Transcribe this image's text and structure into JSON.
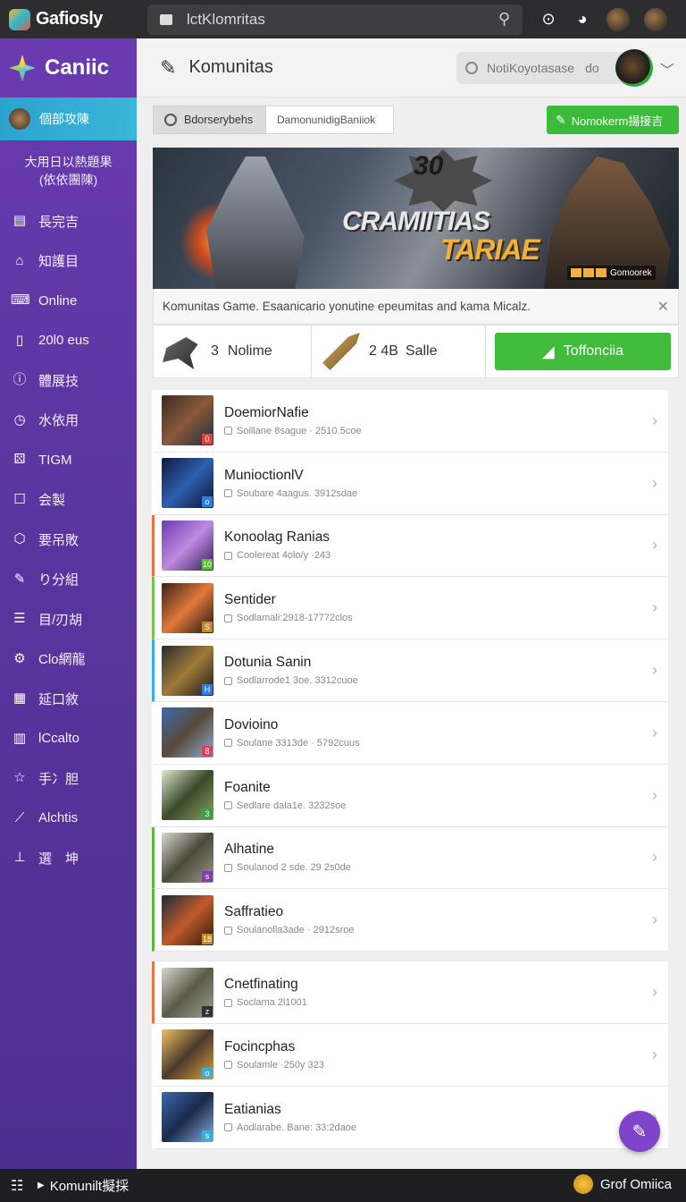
{
  "app": {
    "brand": "Gafiosly"
  },
  "url": {
    "text": "lctKlomritas"
  },
  "sidebar": {
    "title": "Caniic",
    "active_item": "個部攻陳",
    "subtitle_line1": "大用日以熱題果",
    "subtitle_line2": "(依依團陳)",
    "items": [
      {
        "label": "長完吉",
        "icon": "document-icon"
      },
      {
        "label": "知護目",
        "icon": "bag-icon"
      },
      {
        "label": "Online",
        "icon": "terminal-icon"
      },
      {
        "label": "20l0 eus",
        "icon": "book-icon"
      },
      {
        "label": "體展技",
        "icon": "info-icon"
      },
      {
        "label": "水依用",
        "icon": "clock-icon"
      },
      {
        "label": "TIGM",
        "icon": "gamepad-icon"
      },
      {
        "label": "会製",
        "icon": "square-icon"
      },
      {
        "label": "要吊敗",
        "icon": "shield-icon"
      },
      {
        "label": "り分組",
        "icon": "pen-icon"
      },
      {
        "label": "目/刃胡",
        "icon": "list-icon"
      },
      {
        "label": "Clo網龍",
        "icon": "gear-icon"
      },
      {
        "label": "延口敘",
        "icon": "chart-icon"
      },
      {
        "label": "lCcalto",
        "icon": "page-icon"
      },
      {
        "label": "手冫胆",
        "icon": "star-icon"
      },
      {
        "label": "Alchtis",
        "icon": "link-icon"
      },
      {
        "label": "選　坤",
        "icon": "arrow-icon"
      }
    ]
  },
  "header": {
    "title": "Komunitas",
    "notif_text": "NotiKoyotasase",
    "notif_suffix": "do"
  },
  "tabs": [
    {
      "label": "Bdorserybehs"
    },
    {
      "label": "DamonunidigBaniiok"
    }
  ],
  "top_button": {
    "label": "Nomokerm揚接吉"
  },
  "banner": {
    "number": "30",
    "title_line1": "CRAMIITIAS",
    "title_line2": "TARIAE",
    "badge": "Gomoorek"
  },
  "caption": {
    "text": "Komunitas Game. Esaanicario yonutine epeumitas and kama Micalz."
  },
  "stats": {
    "online_count": "3",
    "online_label": "Nolime",
    "sale_count": "2 4B",
    "sale_label": "Salle",
    "action_label": "Toffonciia"
  },
  "list": [
    {
      "title": "DoemiorNafie",
      "sub": "Soillane 8sague · 2510.5coe",
      "accent": "",
      "badge": "0",
      "badge_color": "#e04040",
      "thumb": "linear-gradient(135deg,#3a2a22,#8a5a3a 50%,#1f2a44)"
    },
    {
      "title": "MunioctionlV",
      "sub": "Soubare 4aagus. 3912sdae",
      "accent": "",
      "badge": "o",
      "badge_color": "#2f7de1",
      "thumb": "linear-gradient(135deg,#0e1a3a,#2e5fb0 50%,#0c1430)"
    },
    {
      "title": "Konoolag Ranias",
      "sub": "Coolereat 4olo/y ·243",
      "accent": "#e8734a",
      "badge": "10",
      "badge_color": "#5cb83a",
      "thumb": "linear-gradient(135deg,#6a3bb0,#c08ae0 50%,#2f1c55)"
    },
    {
      "title": "Sentider",
      "sub": "Sodlamali:2918-17772clos",
      "accent": "#7bc24a",
      "badge": "S",
      "badge_color": "#c28a2a",
      "thumb": "linear-gradient(135deg,#3a2018,#e07a3a 50%,#1a1410)"
    },
    {
      "title": "Dotunia Sanin",
      "sub": "Sodlarrode1 3oe. 3312cuoe",
      "accent": "#3ab0d8",
      "badge": "H",
      "badge_color": "#2f7de1",
      "thumb": "linear-gradient(135deg,#2a2a2a,#a07a3a 50%,#1a1a1a)"
    },
    {
      "title": "Dovioino",
      "sub": "Soulane 3313de · 5792cuus",
      "accent": "",
      "badge": "8",
      "badge_color": "#e04060",
      "thumb": "linear-gradient(135deg,#3a6ab0,#5a4a3a 50%,#8ab0d0)"
    },
    {
      "title": "Foanite",
      "sub": "Sedlare dala1e. 3232soe",
      "accent": "",
      "badge": "3",
      "badge_color": "#3aa04a",
      "thumb": "linear-gradient(135deg,#e0e8d0,#3a4a2a 50%,#8aa06a)"
    },
    {
      "title": "Alhatine",
      "sub": "Soulanod 2 sde. 29 2s0de",
      "accent": "#5cb83a",
      "badge": "s",
      "badge_color": "#8a3ab0",
      "thumb": "linear-gradient(135deg,#d8d8d0,#4a4a3a 50%,#9a9a8a)"
    },
    {
      "title": "Saffratieo",
      "sub": "Soulanolla3ade · 2912sroe",
      "accent": "#5cb83a",
      "badge": "18",
      "badge_color": "#c28a2a",
      "thumb": "linear-gradient(135deg,#1a2a3a,#c05a2a 50%,#2a1a10)"
    }
  ],
  "list2": [
    {
      "title": "Cnetfinating",
      "sub": "Soclama 2l1001",
      "accent": "#e8734a",
      "badge": "z",
      "badge_color": "#333333",
      "thumb": "linear-gradient(135deg,#d8d8d0,#5a5a4a 50%,#a0a090)"
    },
    {
      "title": "Focincphas",
      "sub": "Soulamle ·250y 323",
      "accent": "",
      "badge": "o",
      "badge_color": "#3ab0d8",
      "thumb": "linear-gradient(135deg,#f0c060,#4a3a2a 50%,#e0a040)"
    },
    {
      "title": "Eatianias",
      "sub": "Aodlarabe. Bane: 33:2daoe",
      "accent": "",
      "badge": "s",
      "badge_color": "#3ab0d8",
      "thumb": "linear-gradient(135deg,#3a6ab0,#1a2a4a 50%,#8ab0e0)"
    }
  ],
  "bottom": {
    "label": "Komunilt擬採",
    "right_label": "Grof Omiica"
  }
}
